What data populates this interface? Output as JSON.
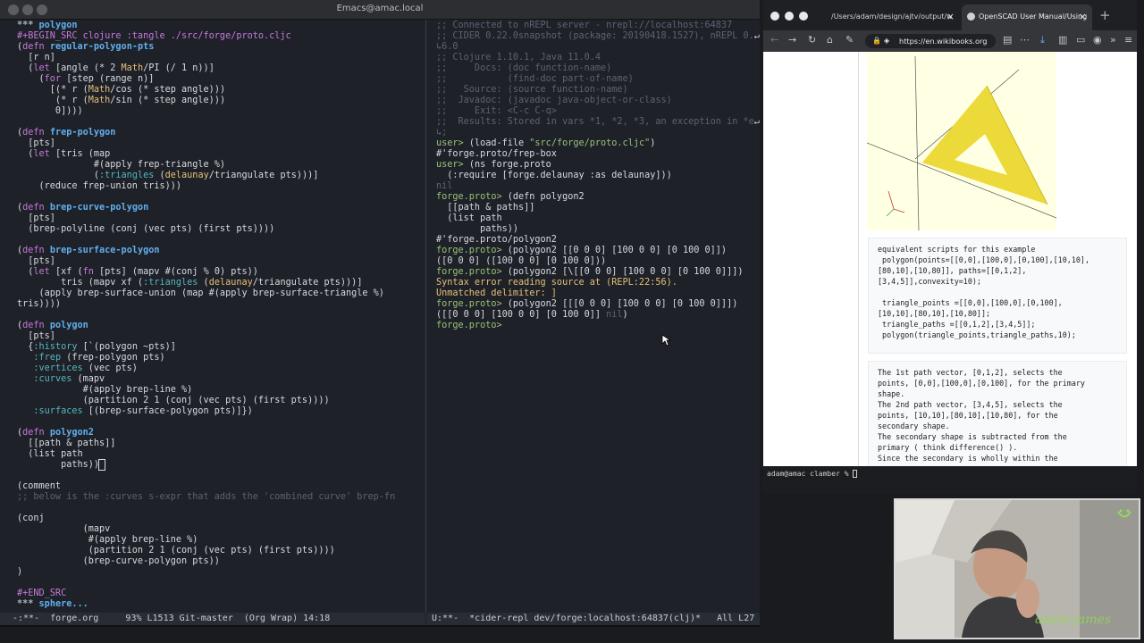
{
  "emacs": {
    "title": "Emacs@amac.local",
    "left_lines": [
      [
        {
          "t": "*** ",
          "c": "#a9b7c6",
          "b": 1
        },
        {
          "t": "polygon",
          "c": "#61afef",
          "b": 1
        }
      ],
      [
        {
          "t": "#+BEGIN_SRC clojure :tangle ./src/forge/proto.cljc",
          "c": "#c678dd"
        }
      ],
      [
        {
          "t": "(",
          "c": "#d7dae0"
        },
        {
          "t": "defn",
          "c": "#c678dd"
        },
        {
          "t": " ",
          "c": "#d7dae0"
        },
        {
          "t": "regular-polygon-pts",
          "c": "#61afef",
          "b": 1
        }
      ],
      [
        {
          "t": "  [r n]",
          "c": "#d7dae0"
        }
      ],
      [
        {
          "t": "  (",
          "c": "#d7dae0"
        },
        {
          "t": "let",
          "c": "#c678dd"
        },
        {
          "t": " [angle (* 2 ",
          "c": "#d7dae0"
        },
        {
          "t": "Math",
          "c": "#e5c07b"
        },
        {
          "t": "/PI (/ 1 n))]",
          "c": "#d7dae0"
        }
      ],
      [
        {
          "t": "    (",
          "c": "#d7dae0"
        },
        {
          "t": "for",
          "c": "#c678dd"
        },
        {
          "t": " [step (range n)]",
          "c": "#d7dae0"
        }
      ],
      [
        {
          "t": "      [(* r (",
          "c": "#d7dae0"
        },
        {
          "t": "Math",
          "c": "#e5c07b"
        },
        {
          "t": "/cos (* step angle)))",
          "c": "#d7dae0"
        }
      ],
      [
        {
          "t": "       (* r (",
          "c": "#d7dae0"
        },
        {
          "t": "Math",
          "c": "#e5c07b"
        },
        {
          "t": "/sin (* step angle)))",
          "c": "#d7dae0"
        }
      ],
      [
        {
          "t": "       0])))",
          "c": "#d7dae0"
        }
      ],
      [
        {
          "t": "",
          "c": "#d7dae0"
        }
      ],
      [
        {
          "t": "(",
          "c": "#d7dae0"
        },
        {
          "t": "defn",
          "c": "#c678dd"
        },
        {
          "t": " ",
          "c": "#d7dae0"
        },
        {
          "t": "frep-polygon",
          "c": "#61afef",
          "b": 1
        }
      ],
      [
        {
          "t": "  [pts]",
          "c": "#d7dae0"
        }
      ],
      [
        {
          "t": "  (",
          "c": "#d7dae0"
        },
        {
          "t": "let",
          "c": "#c678dd"
        },
        {
          "t": " [tris (map",
          "c": "#d7dae0"
        }
      ],
      [
        {
          "t": "              #(apply frep-triangle %)",
          "c": "#d7dae0"
        }
      ],
      [
        {
          "t": "              (",
          "c": "#d7dae0"
        },
        {
          "t": ":triangles",
          "c": "#56b6c2"
        },
        {
          "t": " (",
          "c": "#d7dae0"
        },
        {
          "t": "delaunay",
          "c": "#e5c07b"
        },
        {
          "t": "/triangulate pts)))]",
          "c": "#d7dae0"
        }
      ],
      [
        {
          "t": "    (reduce frep-union tris)))",
          "c": "#d7dae0"
        }
      ],
      [
        {
          "t": "",
          "c": "#d7dae0"
        }
      ],
      [
        {
          "t": "(",
          "c": "#d7dae0"
        },
        {
          "t": "defn",
          "c": "#c678dd"
        },
        {
          "t": " ",
          "c": "#d7dae0"
        },
        {
          "t": "brep-curve-polygon",
          "c": "#61afef",
          "b": 1
        }
      ],
      [
        {
          "t": "  [pts]",
          "c": "#d7dae0"
        }
      ],
      [
        {
          "t": "  (brep-polyline (conj (vec pts) (first pts))))",
          "c": "#d7dae0"
        }
      ],
      [
        {
          "t": "",
          "c": "#d7dae0"
        }
      ],
      [
        {
          "t": "(",
          "c": "#d7dae0"
        },
        {
          "t": "defn",
          "c": "#c678dd"
        },
        {
          "t": " ",
          "c": "#d7dae0"
        },
        {
          "t": "brep-surface-polygon",
          "c": "#61afef",
          "b": 1
        }
      ],
      [
        {
          "t": "  [pts]",
          "c": "#d7dae0"
        }
      ],
      [
        {
          "t": "  (",
          "c": "#d7dae0"
        },
        {
          "t": "let",
          "c": "#c678dd"
        },
        {
          "t": " [xf (",
          "c": "#d7dae0"
        },
        {
          "t": "fn",
          "c": "#c678dd"
        },
        {
          "t": " [pts] (mapv #(conj % 0) pts))",
          "c": "#d7dae0"
        }
      ],
      [
        {
          "t": "        tris (mapv xf (",
          "c": "#d7dae0"
        },
        {
          "t": ":triangles",
          "c": "#56b6c2"
        },
        {
          "t": " (",
          "c": "#d7dae0"
        },
        {
          "t": "delaunay",
          "c": "#e5c07b"
        },
        {
          "t": "/triangulate pts)))]",
          "c": "#d7dae0"
        }
      ],
      [
        {
          "t": "    (apply brep-surface-union (map #(apply brep-surface-triangle %)",
          "c": "#d7dae0"
        }
      ],
      [
        {
          "t": "tris))))",
          "c": "#d7dae0"
        }
      ],
      [
        {
          "t": "",
          "c": "#d7dae0"
        }
      ],
      [
        {
          "t": "(",
          "c": "#d7dae0"
        },
        {
          "t": "defn",
          "c": "#c678dd"
        },
        {
          "t": " ",
          "c": "#d7dae0"
        },
        {
          "t": "polygon",
          "c": "#61afef",
          "b": 1
        }
      ],
      [
        {
          "t": "  [pts]",
          "c": "#d7dae0"
        }
      ],
      [
        {
          "t": "  {",
          "c": "#d7dae0"
        },
        {
          "t": ":history",
          "c": "#56b6c2"
        },
        {
          "t": " [`(polygon ~pts)]",
          "c": "#d7dae0"
        }
      ],
      [
        {
          "t": "   ",
          "c": "#d7dae0"
        },
        {
          "t": ":frep",
          "c": "#56b6c2"
        },
        {
          "t": " (frep-polygon pts)",
          "c": "#d7dae0"
        }
      ],
      [
        {
          "t": "   ",
          "c": "#d7dae0"
        },
        {
          "t": ":vertices",
          "c": "#56b6c2"
        },
        {
          "t": " (vec pts)",
          "c": "#d7dae0"
        }
      ],
      [
        {
          "t": "   ",
          "c": "#d7dae0"
        },
        {
          "t": ":curves",
          "c": "#56b6c2"
        },
        {
          "t": " (mapv",
          "c": "#d7dae0"
        }
      ],
      [
        {
          "t": "            #(apply brep-line %)",
          "c": "#d7dae0"
        }
      ],
      [
        {
          "t": "            (partition 2 1 (conj (vec pts) (first pts))))",
          "c": "#d7dae0"
        }
      ],
      [
        {
          "t": "   ",
          "c": "#d7dae0"
        },
        {
          "t": ":surfaces",
          "c": "#56b6c2"
        },
        {
          "t": " [(brep-surface-polygon pts)]})",
          "c": "#d7dae0"
        }
      ],
      [
        {
          "t": "",
          "c": "#d7dae0"
        }
      ],
      [
        {
          "t": "(",
          "c": "#d7dae0"
        },
        {
          "t": "defn",
          "c": "#c678dd"
        },
        {
          "t": " ",
          "c": "#d7dae0"
        },
        {
          "t": "polygon2",
          "c": "#61afef",
          "b": 1
        }
      ],
      [
        {
          "t": "  [[path & paths]]",
          "c": "#d7dae0"
        }
      ],
      [
        {
          "t": "  (list path",
          "c": "#d7dae0"
        }
      ],
      [
        {
          "t": "        paths))",
          "c": "#d7dae0"
        },
        {
          "t": " ",
          "c": "#d7dae0",
          "cursor": 1
        }
      ],
      [
        {
          "t": "",
          "c": "#d7dae0"
        }
      ],
      [
        {
          "t": "(comment",
          "c": "#d7dae0"
        }
      ],
      [
        {
          "t": ";; below is the :curves s-expr that adds the 'combined curve' brep-fn",
          "c": "#5c6370"
        }
      ],
      [
        {
          "t": "",
          "c": "#d7dae0"
        }
      ],
      [
        {
          "t": "(conj",
          "c": "#d7dae0"
        }
      ],
      [
        {
          "t": "            (mapv",
          "c": "#d7dae0"
        }
      ],
      [
        {
          "t": "             #(apply brep-line %)",
          "c": "#d7dae0"
        }
      ],
      [
        {
          "t": "             (partition 2 1 (conj (vec pts) (first pts))))",
          "c": "#d7dae0"
        }
      ],
      [
        {
          "t": "            (brep-curve-polygon pts))",
          "c": "#d7dae0"
        }
      ],
      [
        {
          "t": ")",
          "c": "#d7dae0"
        }
      ],
      [
        {
          "t": "",
          "c": "#d7dae0"
        }
      ],
      [
        {
          "t": "#+END_SRC",
          "c": "#c678dd"
        }
      ],
      [
        {
          "t": "*** ",
          "c": "#a9b7c6",
          "b": 1
        },
        {
          "t": "sphere...",
          "c": "#61afef",
          "b": 1
        }
      ]
    ],
    "right_lines": [
      [
        {
          "t": ";; Connected to nREPL server - nrepl://localhost:64837",
          "c": "#5c6370"
        }
      ],
      [
        {
          "t": ";; CIDER 0.22.0snapshot (package: 20190418.1527), nREPL 0.",
          "c": "#5c6370"
        },
        {
          "t": "↵",
          "c": "#d7dae0"
        }
      ],
      [
        {
          "t": "↳6.0",
          "c": "#5c6370"
        }
      ],
      [
        {
          "t": ";; Clojure 1.10.1, Java 11.0.4",
          "c": "#5c6370"
        }
      ],
      [
        {
          "t": ";;     Docs: (doc function-name)",
          "c": "#5c6370"
        }
      ],
      [
        {
          "t": ";;           (find-doc part-of-name)",
          "c": "#5c6370"
        }
      ],
      [
        {
          "t": ";;   Source: (source function-name)",
          "c": "#5c6370"
        }
      ],
      [
        {
          "t": ";;  Javadoc: (javadoc java-object-or-class)",
          "c": "#5c6370"
        }
      ],
      [
        {
          "t": ";;     Exit: <C-c C-q>",
          "c": "#5c6370"
        }
      ],
      [
        {
          "t": ";;  Results: Stored in vars *1, *2, *3, an exception in *e",
          "c": "#5c6370"
        },
        {
          "t": "↵",
          "c": "#d7dae0"
        }
      ],
      [
        {
          "t": "↳;",
          "c": "#5c6370"
        }
      ],
      [
        {
          "t": "user> ",
          "c": "#98c379"
        },
        {
          "t": "(load-file ",
          "c": "#d7dae0"
        },
        {
          "t": "\"src/forge/proto.cljc\"",
          "c": "#98c379"
        },
        {
          "t": ")",
          "c": "#d7dae0"
        }
      ],
      [
        {
          "t": "#'forge.proto/frep-box",
          "c": "#d7dae0"
        }
      ],
      [
        {
          "t": "user> ",
          "c": "#98c379"
        },
        {
          "t": "(ns forge.proto",
          "c": "#d7dae0"
        }
      ],
      [
        {
          "t": "  (:require [forge.delaunay :as delaunay]))",
          "c": "#d7dae0"
        }
      ],
      [
        {
          "t": "nil",
          "c": "#5c6370"
        }
      ],
      [
        {
          "t": "forge.proto> ",
          "c": "#98c379"
        },
        {
          "t": "(defn polygon2",
          "c": "#d7dae0"
        }
      ],
      [
        {
          "t": "  [[path & paths]]",
          "c": "#d7dae0"
        }
      ],
      [
        {
          "t": "  (list path",
          "c": "#d7dae0"
        }
      ],
      [
        {
          "t": "        paths))",
          "c": "#d7dae0"
        }
      ],
      [
        {
          "t": "#'forge.proto/polygon2",
          "c": "#d7dae0"
        }
      ],
      [
        {
          "t": "forge.proto> ",
          "c": "#98c379"
        },
        {
          "t": "(polygon2 [[0 0 0] [100 0 0] [0 100 0]])",
          "c": "#d7dae0"
        }
      ],
      [
        {
          "t": "([0 0 0] ([100 0 0] [0 100 0]))",
          "c": "#d7dae0"
        }
      ],
      [
        {
          "t": "forge.proto> ",
          "c": "#98c379"
        },
        {
          "t": "(polygon2 [\\[[0 0 0] [100 0 0] [0 100 0]]])",
          "c": "#d7dae0"
        }
      ],
      [
        {
          "t": "Syntax error reading source at (REPL:22:56).",
          "c": "#e5c07b"
        }
      ],
      [
        {
          "t": "Unmatched delimiter: ]",
          "c": "#e5c07b"
        }
      ],
      [
        {
          "t": "forge.proto> ",
          "c": "#98c379"
        },
        {
          "t": "(polygon2 [[[0 0 0] [100 0 0] [0 100 0]]])",
          "c": "#d7dae0"
        }
      ],
      [
        {
          "t": "([[0 0 0] [100 0 0] [0 100 0]] ",
          "c": "#d7dae0"
        },
        {
          "t": "nil",
          "c": "#5c6370"
        },
        {
          "t": ")",
          "c": "#d7dae0"
        }
      ],
      [
        {
          "t": "forge.proto> ",
          "c": "#98c379"
        }
      ]
    ],
    "modeline_left": "-:**-  forge.org     93% L1513 Git-master  (Org Wrap) 14:18",
    "modeline_right": "U:**-  *cider-repl dev/forge:localhost:64837(clj)*   All L27"
  },
  "browser": {
    "tabs": [
      {
        "label": "/Users/adam/design/ajtv/output/w",
        "active": false
      },
      {
        "label": "OpenSCAD User Manual/Using",
        "active": true
      }
    ],
    "url": "https://en.wikibooks.org",
    "code_block_1": [
      "equivalent scripts for this example",
      " polygon(points=[[0,0],[100,0],[0,100],[10,10],",
      "[80,10],[10,80]], paths=[[0,1,2],",
      "[3,4,5]],convexity=10);",
      "",
      " triangle_points =[[0,0],[100,0],[0,100],",
      "[10,10],[80,10],[10,80]];",
      " triangle_paths =[[0,1,2],[3,4,5]];",
      " polygon(triangle_points,triangle_paths,10);"
    ],
    "code_block_2": [
      "The 1st path vector, [0,1,2], selects the",
      "points, [0,0],[100,0],[0,100], for the primary",
      "shape.",
      "The 2nd path vector, [3,4,5], selects the",
      "points, [10,10],[80,10],[10,80], for the",
      "secondary shape.",
      "The secondary shape is subtracted from the",
      "primary ( think difference() ).",
      "Since the secondary is wholly within the"
    ]
  },
  "terminal": {
    "prompt": "adam@amac clamber % "
  },
  "webcam": {
    "watermark": "adam-james"
  },
  "colors": {
    "emacs_bg": "#1e2127",
    "keyword": "#c678dd",
    "defname": "#61afef",
    "comment": "#5c6370",
    "prompt": "#98c379",
    "error": "#e5c07b",
    "triangle": "#ecd93a"
  }
}
